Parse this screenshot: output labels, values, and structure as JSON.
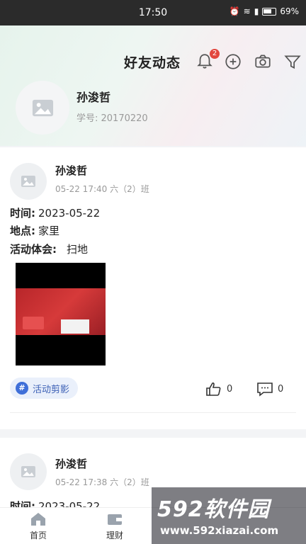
{
  "status": {
    "time": "17:50",
    "battery": "69%"
  },
  "header": {
    "title": "好友动态",
    "notif_count": "2"
  },
  "profile": {
    "name": "孙浚哲",
    "id_label": "学号: 20170220"
  },
  "posts": [
    {
      "name": "孙浚哲",
      "meta": "05-22 17:40 六（2）班",
      "fields": [
        {
          "label": "时间:",
          "value": "2023-05-22"
        },
        {
          "label": "地点:",
          "value": "家里"
        },
        {
          "label": "活动体会:",
          "value": "扫地"
        }
      ],
      "topic": "活动剪影",
      "likes": "0",
      "comments": "0"
    },
    {
      "name": "孙浚哲",
      "meta": "05-22 17:38 六（2）班",
      "fields": [
        {
          "label": "时间:",
          "value": "2023-05-22"
        }
      ]
    }
  ],
  "tabs": [
    {
      "label": "首页"
    },
    {
      "label": "理财"
    }
  ],
  "watermark": {
    "title": "592软件园",
    "url": "www.592xiazai.com"
  }
}
